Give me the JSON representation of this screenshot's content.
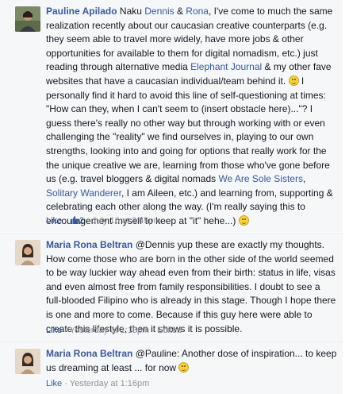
{
  "comments": [
    {
      "author": "Pauline Apilado",
      "segments": [
        {
          "type": "text",
          "value": " Naku "
        },
        {
          "type": "link",
          "value": "Dennis"
        },
        {
          "type": "text",
          "value": " & "
        },
        {
          "type": "link",
          "value": "Rona"
        },
        {
          "type": "text",
          "value": ", I've come to much the same realization recently about our caucasian creative counterparts (e.g. they seem able to travel more widely, have more jobs & other opportunities for available to them for digital nomadism, etc.) just reading through alternative media "
        },
        {
          "type": "link",
          "value": "Elephant Journal"
        },
        {
          "type": "text",
          "value": " & my other fave websites that have a caucasian individual/team behind it. "
        },
        {
          "type": "smiley"
        },
        {
          "type": "text",
          "value": " I personally find it hard to avoid this line of self-questioning at times: \"How can they, when I can't seem to (insert obstacle here)...\"? I guess there's really no other way but through working with or even challenging the \"reality\" we find ourselves in, playing to our own strengths, looking into and going for options that really work for the the unique creative we are, learning from those who've gone before us (e.g. travel bloggers & digital nomads "
        },
        {
          "type": "link",
          "value": "We Are Sole Sisters"
        },
        {
          "type": "text",
          "value": ", "
        },
        {
          "type": "link",
          "value": "Solitary Wanderer"
        },
        {
          "type": "text",
          "value": ", I am Aileen, etc.) and learning from, supporting & celebrating each other along the way. (I'm really saying this to encouragement myself to keep at \"it\" hehe...) "
        },
        {
          "type": "smiley"
        }
      ],
      "like_label": "Like",
      "separator": " · ",
      "like_count": "2",
      "timestamp": "July 16 at 3:45pm",
      "edited": ""
    },
    {
      "author": "Maria Rona Beltran",
      "segments": [
        {
          "type": "text",
          "value": " @Dennis yup these are exactly my thoughts. How come those who are born in the other side of the world seemed to be way luckier way ahead even from their birth: status in life, visas and even almost free from family responsibilities. I doubt to see a full-blooded Filipino who is already in this stage. Though I hope there is one and more to come. Because if this guy here were able to create this lifestyle, then it shows it is possible."
        }
      ],
      "like_label": "Like",
      "separator": " · ",
      "like_count": "",
      "timestamp": "Yesterday at 1:15pm",
      "edited": "Edited"
    },
    {
      "author": "Maria Rona Beltran",
      "segments": [
        {
          "type": "text",
          "value": " @Pauline: Another dose of inspiration... to keep us dreaming at least ... for now "
        },
        {
          "type": "smiley"
        }
      ],
      "like_label": "Like",
      "separator": " · ",
      "like_count": "",
      "timestamp": "Yesterday at 1:16pm",
      "edited": ""
    }
  ],
  "colors": {
    "link": "#3b5998",
    "meta": "#90949c",
    "text": "#141823",
    "background": "#f6f7f8"
  },
  "icons": {
    "like_count_icon": "thumbs-up-icon",
    "emoticon": "smiley-icon"
  }
}
